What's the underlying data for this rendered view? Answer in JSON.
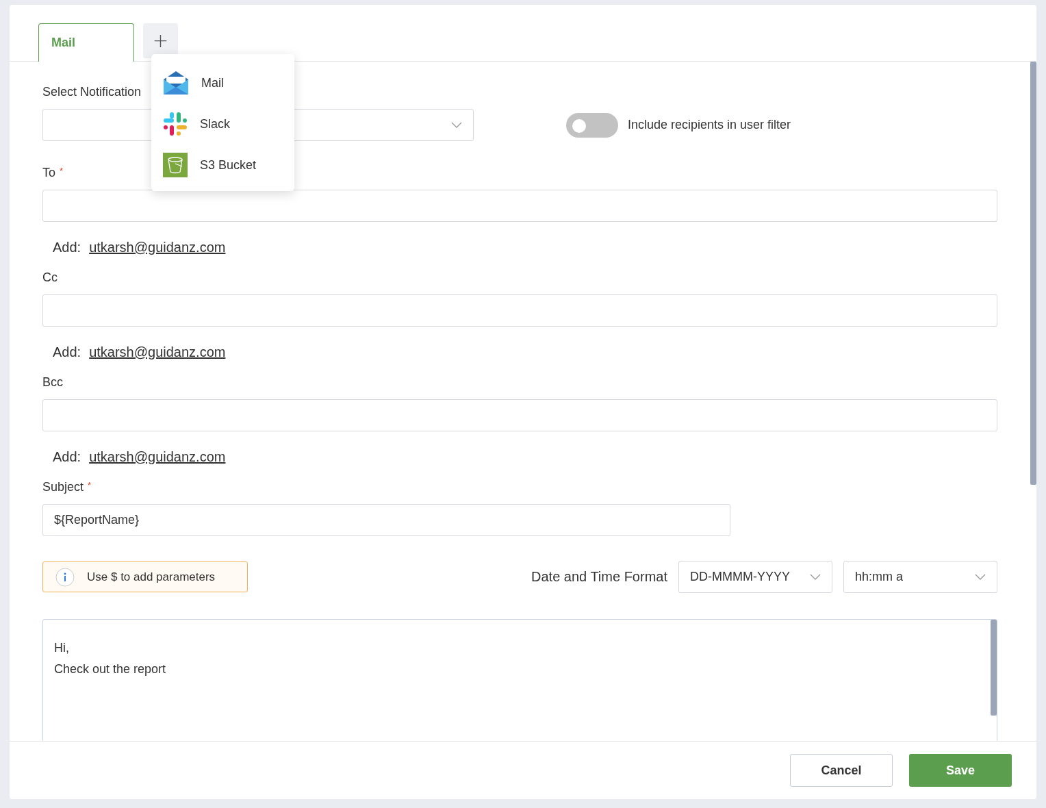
{
  "tabs": [
    {
      "label": "Mail",
      "selected": true
    }
  ],
  "add_tab_button": "+",
  "add_menu": {
    "items": [
      {
        "kind": "mail",
        "label": "Mail"
      },
      {
        "kind": "slack",
        "label": "Slack"
      },
      {
        "kind": "s3",
        "label": "S3 Bucket"
      }
    ]
  },
  "notification": {
    "label": "Select Notification"
  },
  "include_recipients": {
    "label": "Include recipients in user filter",
    "on": false
  },
  "recipients": [
    {
      "label": "To",
      "required_mark": "*",
      "add_label": "Add:",
      "add_email": "utkarsh@guidanz.com"
    },
    {
      "label": "Cc",
      "add_label": "Add:",
      "add_email": "utkarsh@guidanz.com"
    },
    {
      "label": "Bcc",
      "add_label": "Add:",
      "add_email": "utkarsh@guidanz.com"
    }
  ],
  "subject": {
    "label": "Subject",
    "required_mark": "*",
    "value": "${ReportName}"
  },
  "hint": "Use $ to add parameters",
  "date_time_format": {
    "label": "Date and Time Format",
    "date": "DD-MMMM-YYYY",
    "time": "hh:mm a"
  },
  "message_lines": [
    "Hi,",
    "Check out the report"
  ],
  "buttons": {
    "cancel": "Cancel",
    "save": "Save"
  }
}
